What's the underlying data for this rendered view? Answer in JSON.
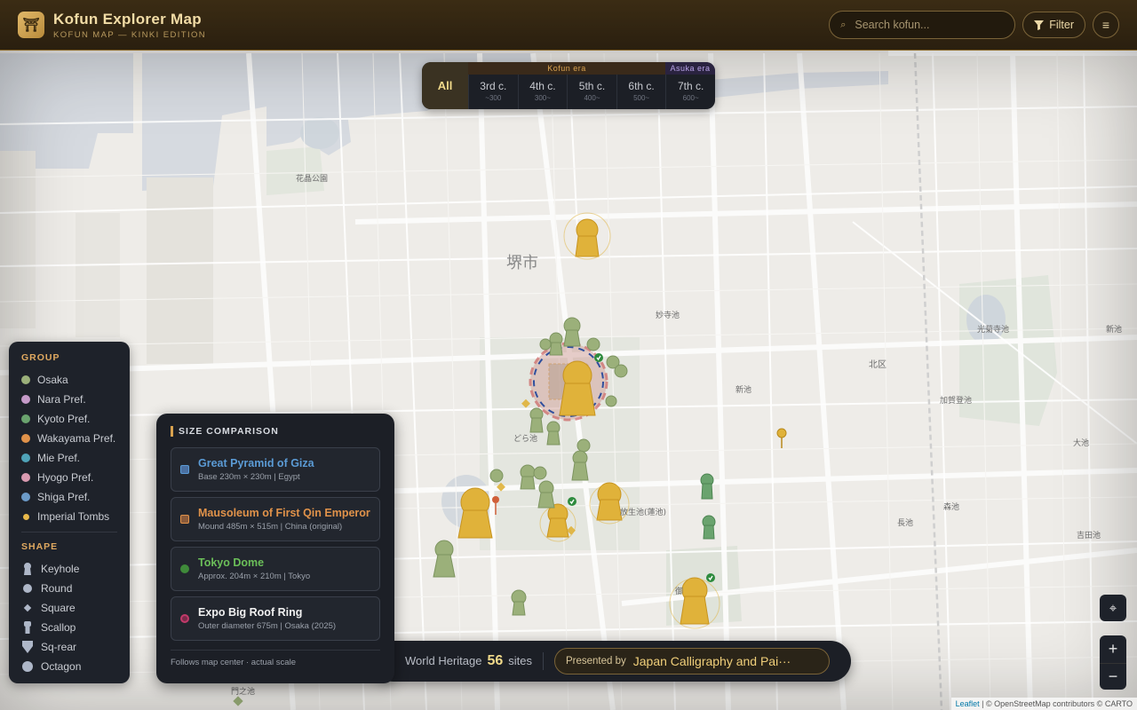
{
  "header": {
    "title": "Kofun Explorer Map",
    "subtitle": "KOFUN MAP — KINKI EDITION",
    "logo_glyph": "⛩",
    "search_placeholder": "Search kofun...",
    "filter_label": "Filter",
    "menu_glyph": "≡"
  },
  "era_filter": {
    "all_label": "All",
    "kofun_label": "Kofun era",
    "asuka_label": "Asuka era",
    "centuries": [
      {
        "label": "3rd c.",
        "year": "~300"
      },
      {
        "label": "4th c.",
        "year": "300~"
      },
      {
        "label": "5th c.",
        "year": "400~"
      },
      {
        "label": "6th c.",
        "year": "500~"
      },
      {
        "label": "7th c.",
        "year": "600~"
      }
    ],
    "colors": {
      "kofun": "#d9a24f",
      "asuka": "#b9a3e8"
    }
  },
  "legend": {
    "group_title": "GROUP",
    "groups": [
      {
        "label": "Osaka",
        "color": "#9bb07a"
      },
      {
        "label": "Nara Pref.",
        "color": "#c59ac8"
      },
      {
        "label": "Kyoto Pref.",
        "color": "#6aa36e"
      },
      {
        "label": "Wakayama Pref.",
        "color": "#e0924a"
      },
      {
        "label": "Mie Pref.",
        "color": "#4fa3b8"
      },
      {
        "label": "Hyogo Pref.",
        "color": "#d99ab0"
      },
      {
        "label": "Shiga Pref.",
        "color": "#6c9bc9"
      },
      {
        "label": "Imperial Tombs",
        "color": "#e8b84a"
      }
    ],
    "shape_title": "SHAPE",
    "shapes": [
      {
        "label": "Keyhole",
        "icon": "keyhole-icon"
      },
      {
        "label": "Round",
        "icon": "round-icon"
      },
      {
        "label": "Square",
        "icon": "square-icon"
      },
      {
        "label": "Scallop",
        "icon": "scallop-icon"
      },
      {
        "label": "Sq-rear",
        "icon": "square-rear-icon"
      },
      {
        "label": "Octagon",
        "icon": "octagon-icon"
      }
    ]
  },
  "size_comparison": {
    "title": "SIZE COMPARISON",
    "items": [
      {
        "name": "Great Pyramid of Giza",
        "desc": "Base 230m × 230m | Egypt",
        "color": "#5b9bd5"
      },
      {
        "name": "Mausoleum of First Qin Emperor",
        "desc": "Mound 485m × 515m | China (original)",
        "color": "#e0924a"
      },
      {
        "name": "Tokyo Dome",
        "desc": "Approx. 204m × 210m | Tokyo",
        "color": "#6bbf59"
      },
      {
        "name": "Expo Big Roof Ring",
        "desc": "Outer diameter 675m | Osaka (2025)",
        "color": "#f0f0f0"
      }
    ],
    "footer": "Follows map center · actual scale"
  },
  "bottom_bar": {
    "heritage_label": "World Heritage",
    "heritage_count": "56",
    "heritage_unit": "sites",
    "presented_by": "Presented by",
    "sponsor": "Japan Calligraphy and Pai···"
  },
  "map": {
    "city_label": "堺市",
    "place_labels": [
      "花晶公園",
      "どら池",
      "妙寺池",
      "新池",
      "北区",
      "加賀登池",
      "光菊寺池",
      "新池",
      "御",
      "長池",
      "大池",
      "放生池(蓮池)",
      "吉田池",
      "森池",
      "門之池"
    ],
    "attribution": {
      "leaflet": "Leaflet",
      "rest": " | © OpenStreetMap contributors © CARTO"
    }
  },
  "controls": {
    "locate_glyph": "⌖",
    "zoom_in": "+",
    "zoom_out": "−"
  }
}
